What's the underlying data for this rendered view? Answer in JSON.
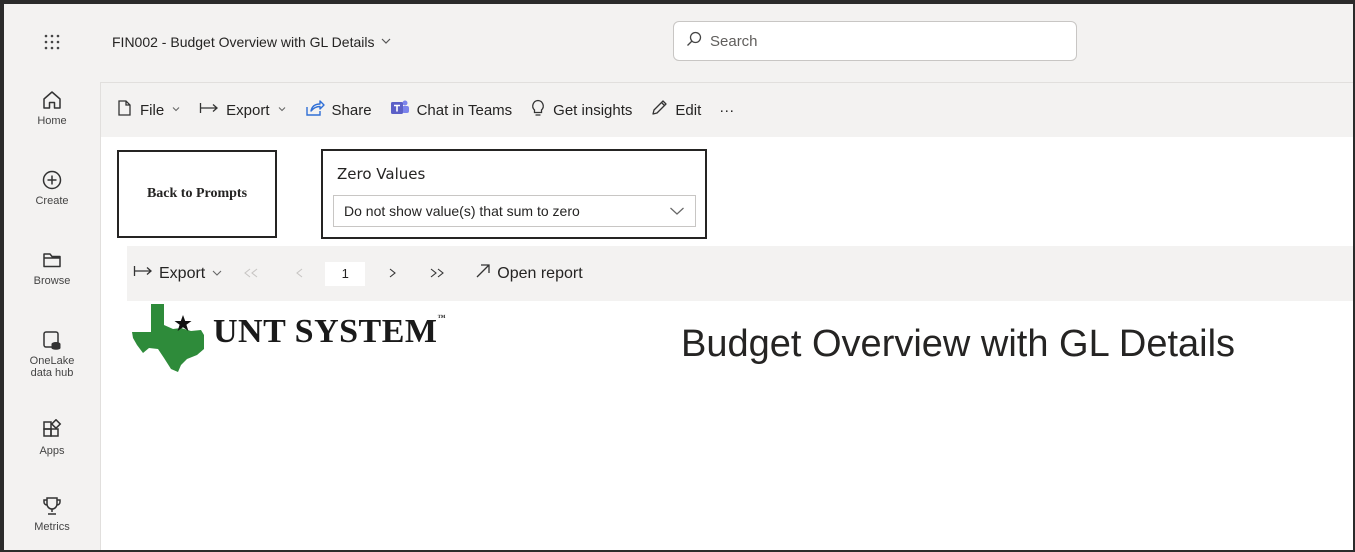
{
  "app": {
    "report_title": "FIN002 - Budget Overview with GL Details",
    "search_placeholder": "Search"
  },
  "rail": {
    "items": [
      {
        "label": "Home",
        "icon": "home-icon"
      },
      {
        "label": "Create",
        "icon": "plus-circle-icon"
      },
      {
        "label": "Browse",
        "icon": "folder-icon"
      },
      {
        "label": "OneLake\ndata hub",
        "icon": "database-icon"
      },
      {
        "label": "Apps",
        "icon": "apps-icon"
      },
      {
        "label": "Metrics",
        "icon": "trophy-icon"
      }
    ]
  },
  "commands": {
    "file": "File",
    "export": "Export",
    "share": "Share",
    "chat": "Chat in Teams",
    "insights": "Get insights",
    "edit": "Edit",
    "more": "···"
  },
  "report": {
    "back_button": "Back to Prompts",
    "slicer_title": "Zero Values",
    "slicer_value": "Do not show value(s) that sum to zero",
    "toolbar": {
      "export": "Export",
      "page": "1",
      "open_report": "Open report"
    },
    "logo_text": "UNT SYSTEM",
    "logo_tm": "™",
    "heading": "Budget Overview with GL Details"
  },
  "colors": {
    "logo_green": "#2e8b3a",
    "teams_purple": "#5b5fc7",
    "share_blue": "#2f6fd6"
  }
}
